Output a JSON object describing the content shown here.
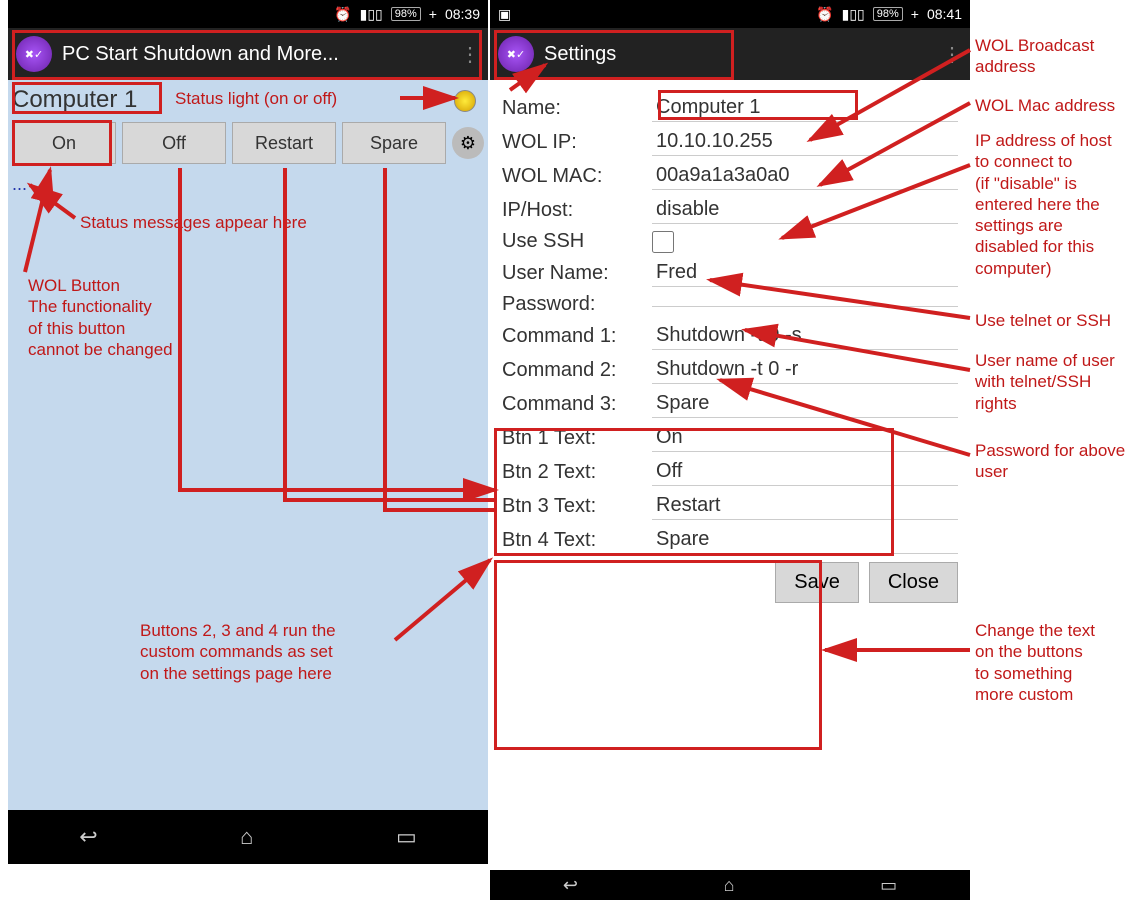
{
  "phone1": {
    "status_time": "08:39",
    "battery": "98%",
    "app_title": "PC Start Shutdown and More...",
    "computer_name": "Computer 1",
    "buttons": [
      "On",
      "Off",
      "Restart",
      "Spare"
    ],
    "status_dots": "..."
  },
  "phone2": {
    "status_time": "08:41",
    "battery": "98%",
    "app_title": "Settings",
    "fields": {
      "name_lbl": "Name:",
      "name_val": "Computer 1",
      "wolip_lbl": "WOL IP:",
      "wolip_val": "10.10.10.255",
      "wolmac_lbl": "WOL MAC:",
      "wolmac_val": "00a9a1a3a0a0",
      "iphost_lbl": "IP/Host:",
      "iphost_val": "disable",
      "usessh_lbl": "Use SSH",
      "username_lbl": "User Name:",
      "username_val": "Fred",
      "password_lbl": "Password:",
      "password_val": "",
      "cmd1_lbl": "Command 1:",
      "cmd1_val": "Shutdown -t 0 -s",
      "cmd2_lbl": "Command 2:",
      "cmd2_val": "Shutdown -t 0 -r",
      "cmd3_lbl": "Command 3:",
      "cmd3_val": "Spare",
      "btn1_lbl": "Btn 1 Text:",
      "btn1_val": "On",
      "btn2_lbl": "Btn 2 Text:",
      "btn2_val": "Off",
      "btn3_lbl": "Btn 3 Text:",
      "btn3_val": "Restart",
      "btn4_lbl": "Btn 4 Text:",
      "btn4_val": "Spare"
    },
    "save": "Save",
    "close": "Close"
  },
  "annotations": {
    "status_light": "Status light (on or off)",
    "status_msg": "Status messages appear here",
    "wol_btn": "WOL Button\nThe functionality\nof this button\ncannot be changed",
    "custom_cmds": "Buttons 2, 3 and 4 run the\ncustom commands as set\non the settings page here",
    "wol_broadcast": "WOL Broadcast\naddress",
    "wol_mac": "WOL Mac address",
    "ip_host": "IP address of host\nto connect to\n(if \"disable\" is\nentered here the\nsettings are\ndisabled for this\ncomputer)",
    "use_ssh": "Use telnet or SSH",
    "username": "User name of user\nwith telnet/SSH\nrights",
    "password": "Password for above\nuser",
    "btn_text": "Change the text\non the buttons\nto something\nmore custom"
  }
}
